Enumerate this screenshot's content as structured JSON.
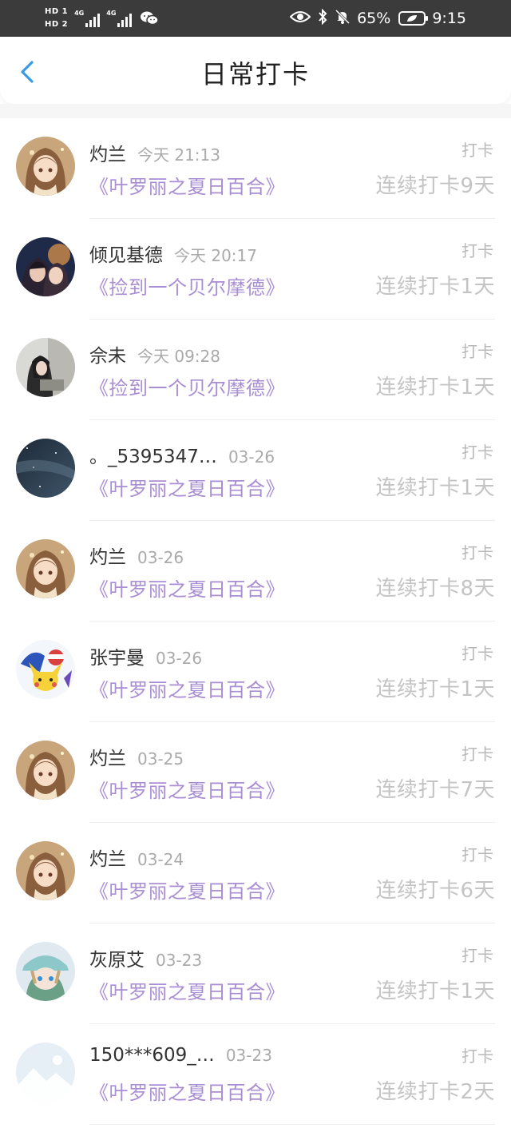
{
  "status_bar": {
    "hd1": "HD 1",
    "hd2": "HD 2",
    "net1": "4G",
    "net2": "4G",
    "battery_percent": "65%",
    "time": "9:15"
  },
  "nav": {
    "title": "日常打卡"
  },
  "entries": [
    {
      "name": "灼兰",
      "time": "今天 21:13",
      "book": "《叶罗丽之夏日百合》",
      "tag": "打卡",
      "streak": "连续打卡9天",
      "avatar": "anime-girl"
    },
    {
      "name": "倾见基德",
      "time": "今天 20:17",
      "book": "《捡到一个贝尔摩德》",
      "tag": "打卡",
      "streak": "连续打卡1天",
      "avatar": "anime-couple"
    },
    {
      "name": "佘未",
      "time": "今天 09:28",
      "book": "《捡到一个贝尔摩德》",
      "tag": "打卡",
      "streak": "连续打卡1天",
      "avatar": "photo-girl"
    },
    {
      "name": "。_5395347…",
      "time": "03-26",
      "book": "《叶罗丽之夏日百合》",
      "tag": "打卡",
      "streak": "连续打卡1天",
      "avatar": "night-sky"
    },
    {
      "name": "灼兰",
      "time": "03-26",
      "book": "《叶罗丽之夏日百合》",
      "tag": "打卡",
      "streak": "连续打卡8天",
      "avatar": "anime-girl"
    },
    {
      "name": "张宇曼",
      "time": "03-26",
      "book": "《叶罗丽之夏日百合》",
      "tag": "打卡",
      "streak": "连续打卡1天",
      "avatar": "pokemon"
    },
    {
      "name": "灼兰",
      "time": "03-25",
      "book": "《叶罗丽之夏日百合》",
      "tag": "打卡",
      "streak": "连续打卡7天",
      "avatar": "anime-girl"
    },
    {
      "name": "灼兰",
      "time": "03-24",
      "book": "《叶罗丽之夏日百合》",
      "tag": "打卡",
      "streak": "连续打卡6天",
      "avatar": "anime-girl"
    },
    {
      "name": "灰原艾",
      "time": "03-23",
      "book": "《叶罗丽之夏日百合》",
      "tag": "打卡",
      "streak": "连续打卡1天",
      "avatar": "anime-cap"
    },
    {
      "name": "150***609_…",
      "time": "03-23",
      "book": "《叶罗丽之夏日百合》",
      "tag": "打卡",
      "streak": "连续打卡2天",
      "avatar": "placeholder"
    }
  ],
  "colors": {
    "accent_purple": "#a98ed3",
    "back_blue": "#3a9be8",
    "status_bar_bg": "#3b3b3b"
  }
}
